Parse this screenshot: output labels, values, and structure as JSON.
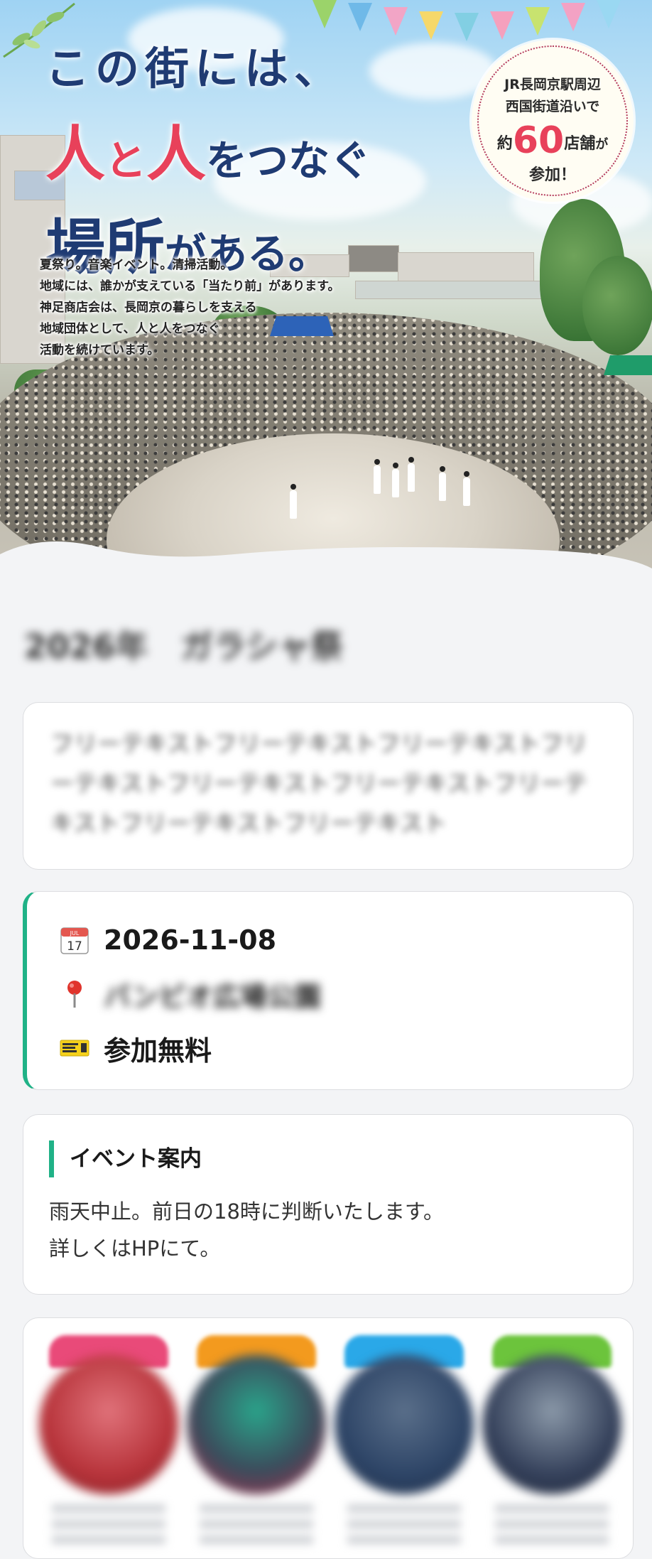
{
  "hero": {
    "title_line1": "この街には、",
    "title_line2_a": "人",
    "title_line2_b": "と",
    "title_line2_c": "人",
    "title_line2_d": "をつなぐ",
    "title_line3_a": "場所",
    "title_line3_b": "がある。",
    "description": [
      "夏祭り。音楽イベント。清掃活動。",
      "地域には、誰かが支えている「当たり前」があります。",
      "神足商店会は、長岡京の暮らしを支える",
      "地域団体として、人と人をつなぐ",
      "活動を続けています。"
    ],
    "badge": {
      "line1": "JR長岡京駅周辺",
      "line2": "西国街道沿いで",
      "prefix": "約",
      "count": "60",
      "suffix": "店舗",
      "particle": "が",
      "line4": "参加！"
    }
  },
  "event": {
    "title": "2026年　ガラシャ祭",
    "free_text": "フリーテキストフリーテキストフリーテキストフリーテキストフリーテキストフリーテキストフリーテキストフリーテキストフリーテキスト"
  },
  "info": {
    "date": "2026-11-08",
    "date_icon": "calendar-icon",
    "place": "バンビオ広場公園",
    "place_icon": "pin-icon",
    "fee": "参加無料",
    "fee_icon": "ticket-icon",
    "accent_color": "#20b287"
  },
  "guide": {
    "heading": "イベント案内",
    "body_line1": "雨天中止。前日の18時に判断いたします。",
    "body_line2": "詳しくはHPにて。"
  },
  "shops": {
    "tag_colors": [
      "#e94a79",
      "#f39a1e",
      "#2aa8e8",
      "#6cc43c"
    ],
    "circle_colors": [
      "#b7333a",
      "#3b4c5c",
      "#2d4466",
      "#34405a"
    ]
  }
}
